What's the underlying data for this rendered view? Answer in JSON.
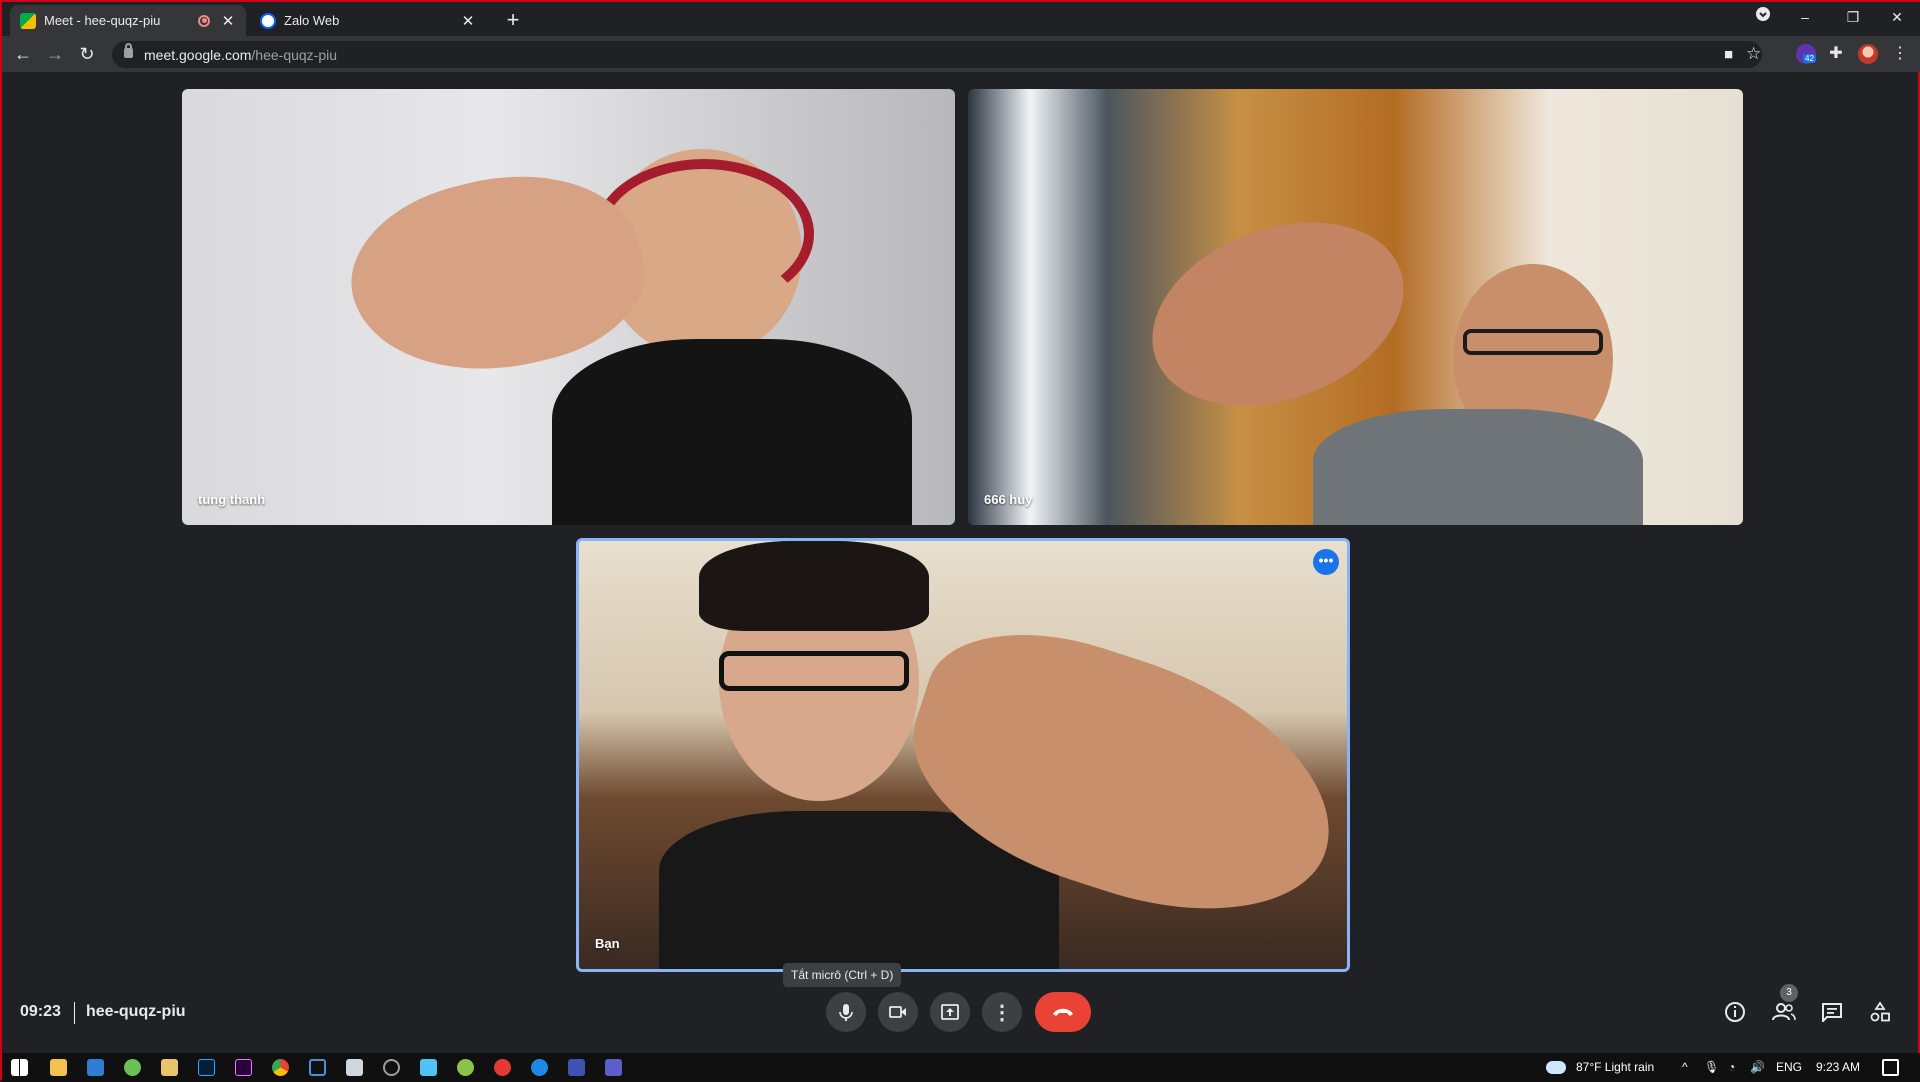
{
  "browser": {
    "tabs": [
      {
        "title": "Meet - hee-quqz-piu",
        "active": true,
        "recording": true
      },
      {
        "title": "Zalo Web",
        "active": false
      }
    ],
    "url_host": "meet.google.com",
    "url_path": "/hee-quqz-piu",
    "extension_badge": "42"
  },
  "meet": {
    "participants": [
      {
        "name": "tung thanh"
      },
      {
        "name": "666 huy"
      },
      {
        "name": "Bạn"
      }
    ],
    "tooltip": "Tắt micrô (Ctrl + D)",
    "time": "09:23",
    "meeting_code": "hee-quqz-piu",
    "people_count": "3"
  },
  "taskbar": {
    "weather": "87°F  Light rain",
    "language": "ENG",
    "clock": "9:23 AM"
  },
  "colors": {
    "accent": "#8ab4f8",
    "end_call": "#ea4335",
    "background": "#202124"
  }
}
